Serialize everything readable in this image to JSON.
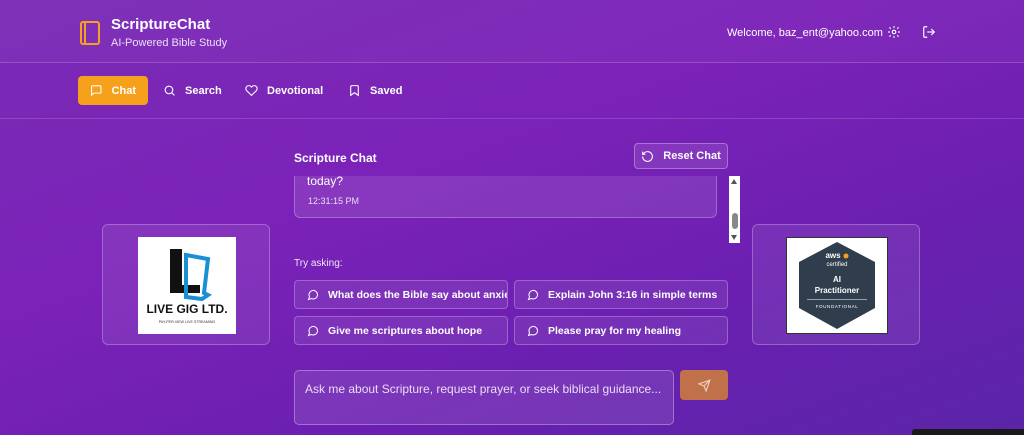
{
  "app": {
    "title": "ScriptureChat",
    "subtitle": "AI-Powered Bible Study",
    "welcome": "Welcome, baz_ent@yahoo.com"
  },
  "nav": {
    "items": [
      {
        "label": "Chat",
        "icon": "message-square-icon",
        "active": true
      },
      {
        "label": "Search",
        "icon": "search-icon",
        "active": false
      },
      {
        "label": "Devotional",
        "icon": "heart-icon",
        "active": false
      },
      {
        "label": "Saved",
        "icon": "bookmark-icon",
        "active": false
      }
    ]
  },
  "chat": {
    "title": "Scripture Chat",
    "reset_label": "Reset Chat",
    "last_message": {
      "text": "today?",
      "time": "12:31:15 PM"
    },
    "try_asking_label": "Try asking:",
    "suggestions": [
      "What does the Bible say about anxiety?",
      "Explain John 3:16 in simple terms",
      "Give me scriptures about hope",
      "Please pray for my healing"
    ],
    "input_placeholder": "Ask me about Scripture, request prayer, or seek biblical guidance...",
    "input_value": ""
  },
  "sidebar_ads": {
    "left": {
      "alt": "LIVE GIG LTD. logo"
    },
    "right": {
      "alt": "AWS Certified AI Practitioner Foundational badge"
    }
  },
  "colors": {
    "accent": "#f7a01b",
    "send_button": "#c0714a",
    "background": "#7b22b8"
  }
}
